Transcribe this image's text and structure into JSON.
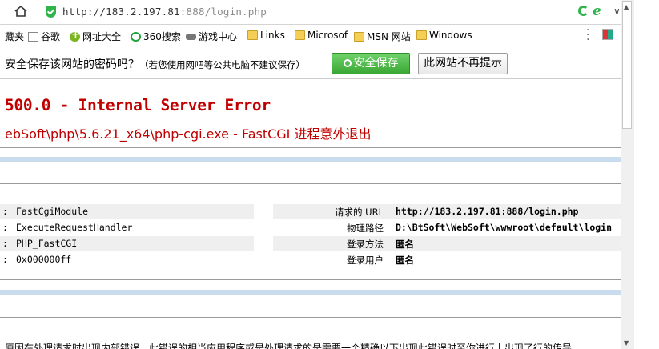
{
  "address_bar": {
    "url_host": "http://183.2.197.81",
    "url_rest": ":888/login.php"
  },
  "bookmarks": [
    {
      "label": "藏夹",
      "icon": "none"
    },
    {
      "label": "谷歌",
      "icon": "page-icon"
    },
    {
      "label": "网址大全",
      "icon": "plus-icon"
    },
    {
      "label": "360搜索",
      "icon": "o-icon"
    },
    {
      "label": "游戏中心",
      "icon": "game-icon"
    },
    {
      "label": "Links",
      "icon": "folder-icon"
    },
    {
      "label": "Microsof",
      "icon": "folder-icon"
    },
    {
      "label": "MSN 网站",
      "icon": "folder-icon"
    },
    {
      "label": "Windows",
      "icon": "folder-icon"
    }
  ],
  "password_bar": {
    "question": "安全保存该网站的密码吗？",
    "note": "（若您使用网吧等公共电脑不建议保存）",
    "save_label": "安全保存",
    "never_label": "此网站不再提示"
  },
  "error": {
    "title": "500.0 - Internal Server Error",
    "subtitle": "ebSoft\\php\\5.6.21_x64\\php-cgi.exe - FastCGI 进程意外退出"
  },
  "details": [
    {
      "left_value": "FastCgiModule",
      "right_label": "请求的 URL",
      "right_value": "http://183.2.197.81:888/login.php"
    },
    {
      "left_value": "ExecuteRequestHandler",
      "right_label": "物理路径",
      "right_value": "D:\\BtSoft\\WebSoft\\wwwroot\\default\\login"
    },
    {
      "left_value": "PHP_FastCGI",
      "right_label": "登录方法",
      "right_value": "匿名"
    },
    {
      "left_value": "0x000000ff",
      "right_label": "登录用户",
      "right_value": "匿名"
    }
  ],
  "cut_text": "原因在外理请求时出现内部错误，此错误的相当应用程序或是处理请求的是需要一个精确以下出现此错误时至你进行上出现了行的传导"
}
